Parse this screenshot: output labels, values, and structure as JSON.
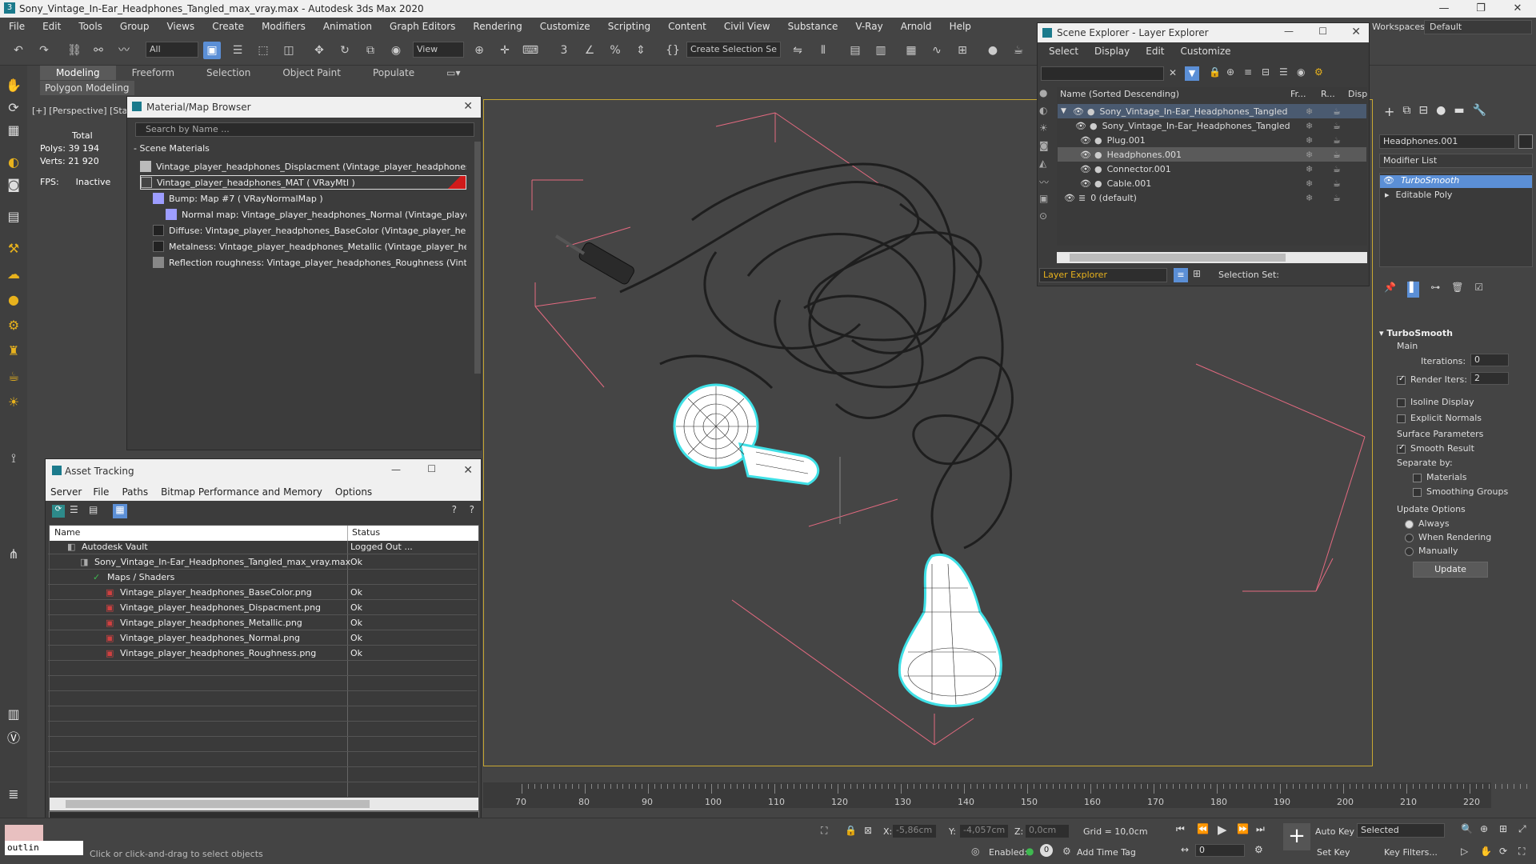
{
  "window": {
    "title": "Sony_Vintage_In-Ear_Headphones_Tangled_max_vray.max - Autodesk 3ds Max 2020"
  },
  "menu": [
    "File",
    "Edit",
    "Tools",
    "Group",
    "Views",
    "Create",
    "Modifiers",
    "Animation",
    "Graph Editors",
    "Rendering",
    "Customize",
    "Scripting",
    "Content",
    "Civil View",
    "Substance",
    "V-Ray",
    "Arnold",
    "Help"
  ],
  "toolbar": {
    "filter_value": "All",
    "view_value": "View",
    "selection_set_placeholder": "Create Selection Se",
    "workspaces_label": "Workspaces:",
    "workspaces_value": "Default"
  },
  "ribbon": {
    "tabs": [
      "Modeling",
      "Freeform",
      "Selection",
      "Object Paint",
      "Populate"
    ],
    "sub": "Polygon Modeling"
  },
  "viewport": {
    "label": "[+] [Perspective] [Standard]",
    "stats": {
      "total_label": "Total",
      "polys_label": "Polys:",
      "polys": "39 194",
      "verts_label": "Verts:",
      "verts": "21 920",
      "fps_label": "FPS:",
      "fps": "Inactive"
    }
  },
  "material_browser": {
    "title": "Material/Map Browser",
    "search_placeholder": "Search by Name ...",
    "section": "- Scene Materials",
    "rows": [
      "Vintage_player_headphones_Displacment (Vintage_player_headphones_Di...",
      "Vintage_player_headphones_MAT  ( VRayMtl )",
      "Bump: Map #7  ( VRayNormalMap )",
      "Normal map: Vintage_player_headphones_Normal (Vintage_player_...",
      "Diffuse: Vintage_player_headphones_BaseColor (Vintage_player_headp...",
      "Metalness: Vintage_player_headphones_Metallic (Vintage_player_head...",
      "Reflection roughness: Vintage_player_headphones_Roughness (Vintage..."
    ]
  },
  "asset_tracking": {
    "title": "Asset Tracking",
    "menu": [
      "Server",
      "File",
      "Paths",
      "Bitmap Performance and Memory",
      "Options"
    ],
    "columns": [
      "Name",
      "Status"
    ],
    "rows": [
      {
        "name": "Autodesk Vault",
        "status": "Logged Out ..."
      },
      {
        "name": "Sony_Vintage_In-Ear_Headphones_Tangled_max_vray.max",
        "status": "Ok"
      },
      {
        "name": "Maps / Shaders",
        "status": ""
      },
      {
        "name": "Vintage_player_headphones_BaseColor.png",
        "status": "Ok"
      },
      {
        "name": "Vintage_player_headphones_Dispacment.png",
        "status": "Ok"
      },
      {
        "name": "Vintage_player_headphones_Metallic.png",
        "status": "Ok"
      },
      {
        "name": "Vintage_player_headphones_Normal.png",
        "status": "Ok"
      },
      {
        "name": "Vintage_player_headphones_Roughness.png",
        "status": "Ok"
      }
    ]
  },
  "scene_explorer": {
    "title": "Scene Explorer - Layer Explorer",
    "menu": [
      "Select",
      "Display",
      "Edit",
      "Customize"
    ],
    "columns": {
      "name": "Name (Sorted Descending)",
      "fr": "Fr...",
      "r": "R...",
      "disp": "Disp"
    },
    "rows": [
      "Sony_Vintage_In-Ear_Headphones_Tangled",
      "Sony_Vintage_In-Ear_Headphones_Tangled",
      "Plug.001",
      "Headphones.001",
      "Connector.001",
      "Cable.001",
      "0 (default)"
    ],
    "footer_dropdown": "Layer Explorer",
    "selection_set_label": "Selection Set:"
  },
  "command_panel": {
    "object_name": "Headphones.001",
    "modifier_list": "Modifier List",
    "stack": [
      "TurboSmooth",
      "Editable Poly"
    ],
    "rollout_title": "TurboSmooth",
    "main_label": "Main",
    "iterations_label": "Iterations:",
    "iterations": "0",
    "render_iters_label": "Render Iters:",
    "render_iters": "2",
    "isoline": "Isoline Display",
    "explicit": "Explicit Normals",
    "surface_params": "Surface Parameters",
    "smooth_result": "Smooth Result",
    "separate_by": "Separate by:",
    "materials": "Materials",
    "smoothing_groups": "Smoothing Groups",
    "update_options": "Update Options",
    "always": "Always",
    "when_rendering": "When Rendering",
    "manually": "Manually",
    "update_btn": "Update"
  },
  "timeline": {
    "ticks": [
      "70",
      "80",
      "90",
      "100",
      "110",
      "120",
      "130",
      "140",
      "150",
      "160",
      "170",
      "180",
      "190",
      "200",
      "210",
      "220"
    ]
  },
  "status": {
    "script_text": "outlin",
    "prompt": "Click or click-and-drag to select objects",
    "x_label": "X:",
    "x": "-5,86cm",
    "y_label": "Y:",
    "y": "-4,057cm",
    "z_label": "Z:",
    "z": "0,0cm",
    "grid": "Grid = 10,0cm",
    "enabled": "Enabled:",
    "add_time_tag": "Add Time Tag",
    "auto_key": "Auto Key",
    "set_key": "Set Key",
    "selected": "Selected",
    "key_filters": "Key Filters...",
    "frame": "0"
  }
}
